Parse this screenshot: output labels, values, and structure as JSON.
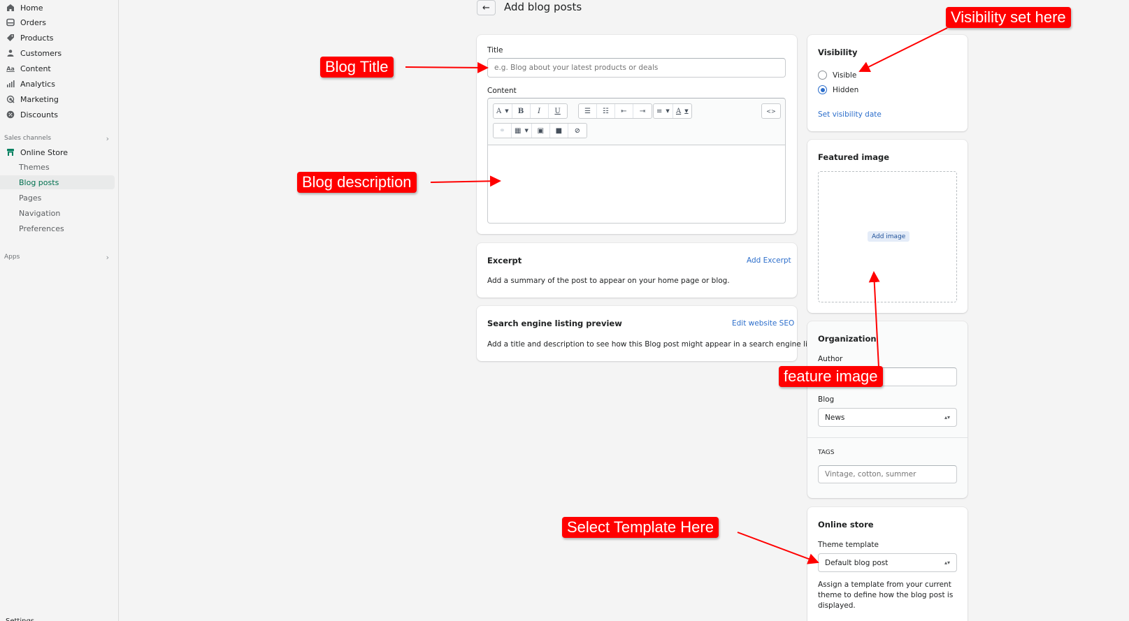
{
  "sidebar": {
    "items": [
      {
        "label": "Home",
        "icon": "home-icon"
      },
      {
        "label": "Orders",
        "icon": "orders-icon"
      },
      {
        "label": "Products",
        "icon": "tag-icon"
      },
      {
        "label": "Customers",
        "icon": "person-icon"
      },
      {
        "label": "Content",
        "icon": "content-icon"
      },
      {
        "label": "Analytics",
        "icon": "bar-chart-icon"
      },
      {
        "label": "Marketing",
        "icon": "marketing-icon"
      },
      {
        "label": "Discounts",
        "icon": "discount-icon"
      }
    ],
    "sales_channels_label": "Sales channels",
    "online_store_label": "Online Store",
    "sub_items": [
      {
        "label": "Themes"
      },
      {
        "label": "Blog posts",
        "active": true
      },
      {
        "label": "Pages"
      },
      {
        "label": "Navigation"
      },
      {
        "label": "Preferences"
      }
    ],
    "apps_label": "Apps",
    "settings_label": "Settings"
  },
  "header": {
    "back_icon": "arrow-left-icon",
    "title": "Add blog posts"
  },
  "main": {
    "title_label": "Title",
    "title_placeholder": "e.g. Blog about your latest products or deals",
    "title_value": "",
    "content_label": "Content",
    "toolbar": {
      "row1": [
        "A",
        "B",
        "I",
        "U",
        "bullet-list",
        "numbered-list",
        "outdent",
        "indent",
        "align",
        "text-color",
        "html"
      ],
      "row2": [
        "link",
        "table",
        "image",
        "video",
        "clear-format"
      ]
    },
    "excerpt": {
      "title": "Excerpt",
      "action": "Add Excerpt",
      "description": "Add a summary of the post to appear on your home page or blog."
    },
    "seo": {
      "title": "Search engine listing preview",
      "action": "Edit website SEO",
      "description": "Add a title and description to see how this Blog post might appear in a search engine listing"
    }
  },
  "right": {
    "visibility": {
      "title": "Visibility",
      "options": [
        {
          "label": "Visible",
          "checked": false
        },
        {
          "label": "Hidden",
          "checked": true
        }
      ],
      "set_date_link": "Set visibility date"
    },
    "featured_image": {
      "title": "Featured image",
      "add_button": "Add image"
    },
    "organization": {
      "title": "Organization",
      "author_label": "Author",
      "author_value": "",
      "blog_label": "Blog",
      "blog_value": "News",
      "tags_label": "TAGS",
      "tags_placeholder": "Vintage, cotton, summer"
    },
    "online_store": {
      "title": "Online store",
      "template_label": "Theme template",
      "template_value": "Default blog post",
      "help_text": "Assign a template from your current theme to define how the blog post is displayed."
    }
  },
  "annotations": {
    "blog_title": "Blog Title",
    "blog_description": "Blog description",
    "visibility": "Visibility set here",
    "feature_image": "feature image",
    "select_template": "Select Template Here",
    "color": "#ff0000"
  }
}
